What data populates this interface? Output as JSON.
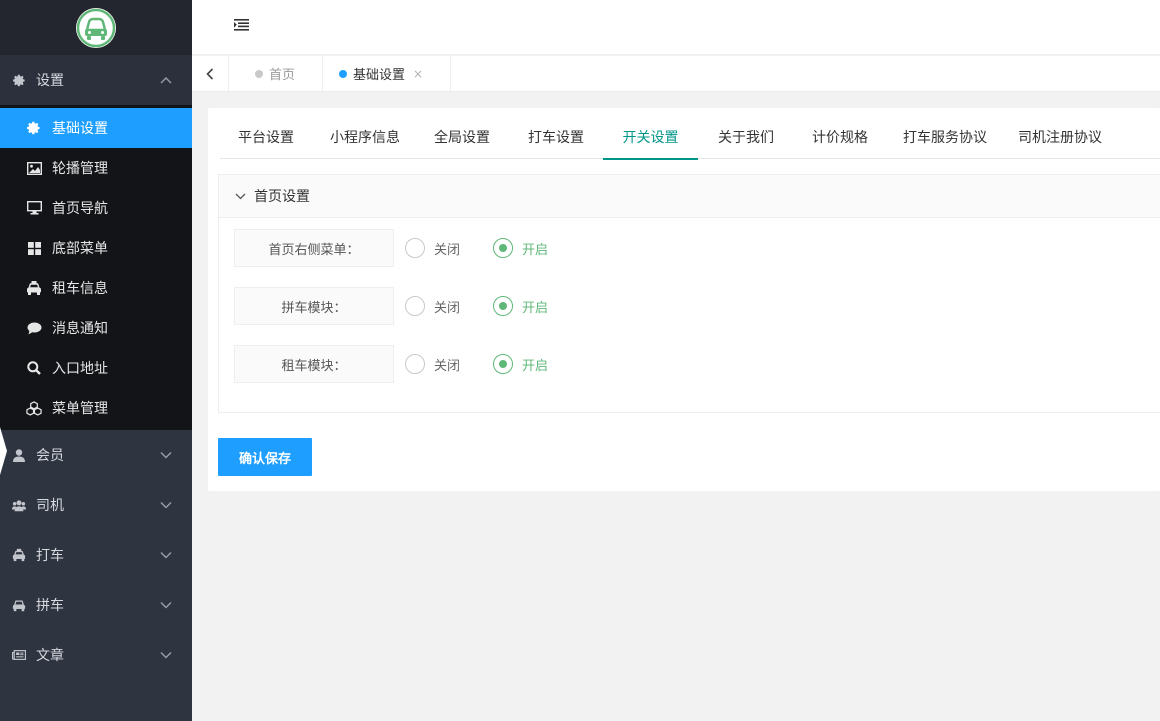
{
  "colors": {
    "sidebar_bg": "#2f3441",
    "submenu_bg": "#121417",
    "active_blue": "#1e9fff",
    "tab_active": "#009688",
    "radio_on": "#5fb878"
  },
  "sidebar": {
    "settings_group": {
      "label": "设置",
      "icon": "gear-icon",
      "items": [
        {
          "label": "基础设置",
          "icon": "gear-icon",
          "active": true
        },
        {
          "label": "轮播管理",
          "icon": "image-icon"
        },
        {
          "label": "首页导航",
          "icon": "monitor-icon"
        },
        {
          "label": "底部菜单",
          "icon": "grid-icon"
        },
        {
          "label": "租车信息",
          "icon": "taxi-icon"
        },
        {
          "label": "消息通知",
          "icon": "chat-bubble-icon"
        },
        {
          "label": "入口地址",
          "icon": "search-icon"
        },
        {
          "label": "菜单管理",
          "icon": "cubes-icon"
        }
      ]
    },
    "groups": [
      {
        "label": "会员",
        "icon": "user-icon"
      },
      {
        "label": "司机",
        "icon": "users-icon"
      },
      {
        "label": "打车",
        "icon": "taxi-icon"
      },
      {
        "label": "拼车",
        "icon": "car-icon"
      },
      {
        "label": "文章",
        "icon": "newspaper-icon"
      }
    ]
  },
  "page_tabs": [
    {
      "label": "首页",
      "active": false
    },
    {
      "label": "基础设置",
      "active": true,
      "close": "×"
    }
  ],
  "settings_tabs": [
    "平台设置",
    "小程序信息",
    "全局设置",
    "打车设置",
    "开关设置",
    "关于我们",
    "计价规格",
    "打车服务协议",
    "司机注册协议"
  ],
  "active_settings_tab": "开关设置",
  "panel": {
    "title": "首页设置",
    "rows": [
      {
        "label": "首页右侧菜单：",
        "off": "关闭",
        "on": "开启",
        "value": "开启"
      },
      {
        "label": "拼车模块：",
        "off": "关闭",
        "on": "开启",
        "value": "开启"
      },
      {
        "label": "租车模块：",
        "off": "关闭",
        "on": "开启",
        "value": "开启"
      }
    ]
  },
  "save_button": "确认保存"
}
